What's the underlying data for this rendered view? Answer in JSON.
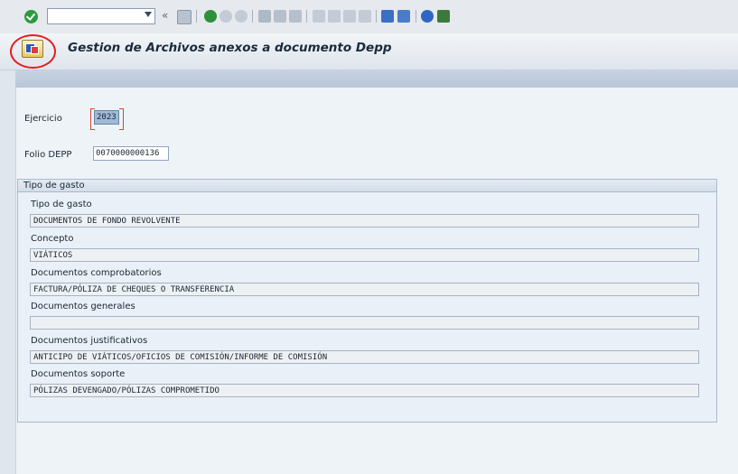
{
  "header": {
    "title": "Gestion de Archivos anexos a documento Depp"
  },
  "toolbar": {
    "command_value": "",
    "icons": [
      "check-icon",
      "back-double-icon",
      "save-icon",
      "back-icon",
      "exit-icon",
      "cancel-icon",
      "print-icon",
      "find-icon",
      "find-next-icon",
      "first-page-icon",
      "prev-page-icon",
      "next-page-icon",
      "last-page-icon",
      "new-session-icon",
      "shortcut-icon",
      "help-icon",
      "customize-icon"
    ]
  },
  "form": {
    "ejercicio_label": "Ejercicio",
    "ejercicio_value": "2023",
    "folio_label": "Folio DEPP",
    "folio_value": "0070000000136"
  },
  "group": {
    "title": "Tipo de gasto",
    "fields": [
      {
        "label": "Tipo de gasto",
        "value": "DOCUMENTOS DE FONDO REVOLVENTE"
      },
      {
        "label": "Concepto",
        "value": "VIÁTICOS"
      },
      {
        "label": "Documentos comprobatorios",
        "value": "FACTURA/PÓLIZA DE CHEQUES O TRANSFERENCIA"
      },
      {
        "label": "Documentos generales",
        "value": ""
      },
      {
        "label": "Documentos justificativos",
        "value": "ANTICIPO DE VIÁTICOS/OFICIOS DE COMISIÓN/INFORME DE COMISIÓN"
      },
      {
        "label": "Documentos soporte",
        "value": "PÓLIZAS DEVENGADO/PÓLIZAS COMPROMETIDO"
      }
    ]
  },
  "colors": {
    "accent_circle": "#e01e1e",
    "selected_field": "#9fb9d6"
  }
}
